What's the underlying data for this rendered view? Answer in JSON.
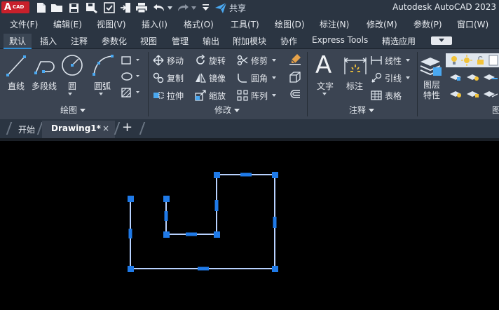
{
  "titlebar": {
    "logo_big": "A",
    "logo_small": "CAD",
    "share_label": "共享",
    "app_title": "Autodesk AutoCAD 2023"
  },
  "menubar": {
    "items": [
      "文件(F)",
      "编辑(E)",
      "视图(V)",
      "插入(I)",
      "格式(O)",
      "工具(T)",
      "绘图(D)",
      "标注(N)",
      "修改(M)",
      "参数(P)",
      "窗口(W)"
    ]
  },
  "ribbon_tabs": {
    "items": [
      "默认",
      "插入",
      "注释",
      "参数化",
      "视图",
      "管理",
      "输出",
      "附加模块",
      "协作",
      "Express Tools",
      "精选应用"
    ],
    "active_index": 0
  },
  "ribbon": {
    "draw": {
      "line": "直线",
      "polyline": "多段线",
      "circle": "圆",
      "arc": "圆弧",
      "footer": "绘图"
    },
    "modify": {
      "move": "移动",
      "rotate": "旋转",
      "trim": "修剪",
      "copy": "复制",
      "mirror": "镜像",
      "fillet": "圆角",
      "stretch": "拉伸",
      "scale": "缩放",
      "array": "阵列",
      "footer": "修改"
    },
    "annotation": {
      "text": "文字",
      "dimension": "标注",
      "linear": "线性",
      "leader": "引线",
      "table": "表格",
      "footer": "注释"
    },
    "layers": {
      "layer_properties": "图层\n特性",
      "footer_partial": "图"
    }
  },
  "doc_tabs": {
    "start": "开始",
    "drawing": "Drawing1*",
    "close_glyph": "×",
    "plus_glyph": "+"
  },
  "colors": {
    "chrome": "#2b3542",
    "ribbon": "#3b4452",
    "accent_blue": "#2f8fd8",
    "grip_blue": "#1f7ae8",
    "selected_line": "#9fc2ff",
    "logo_red": "#c8202b"
  }
}
